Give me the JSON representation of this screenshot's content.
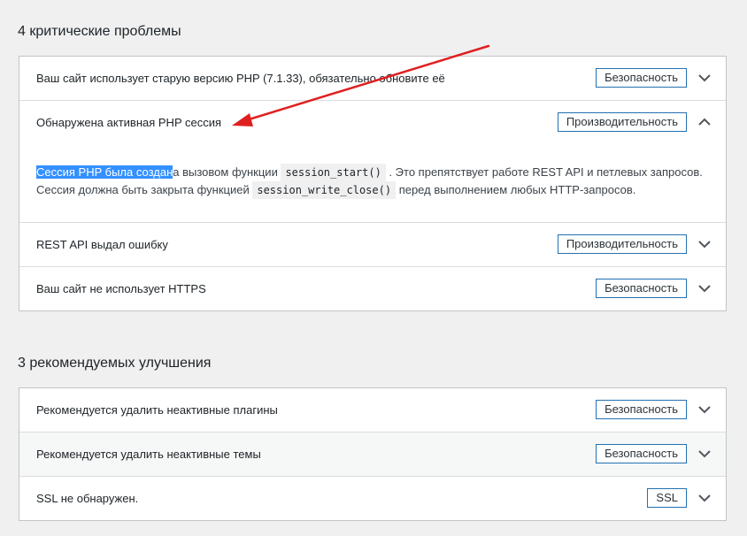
{
  "critical": {
    "heading": "4 критические проблемы",
    "items": [
      {
        "title": "Ваш сайт использует старую версию PHP (7.1.33), обязательно обновите её",
        "badge": "Безопасность",
        "expanded": false
      },
      {
        "title": "Обнаружена активная PHP сессия",
        "badge": "Производительность",
        "expanded": true,
        "body": {
          "selected_text": "Сессия PHP была создан",
          "text_1": "а вызовом функции",
          "code_1": "session_start()",
          "text_2": ". Это препятствует работе REST API и петлевых запросов.",
          "text_3": "Сессия должна быть закрыта функцией",
          "code_2": "session_write_close()",
          "text_4": "перед выполнением любых HTTP-запросов."
        }
      },
      {
        "title": "REST API выдал ошибку",
        "badge": "Производительность",
        "expanded": false
      },
      {
        "title": "Ваш сайт не использует HTTPS",
        "badge": "Безопасность",
        "expanded": false
      }
    ]
  },
  "recommended": {
    "heading": "3 рекомендуемых улучшения",
    "items": [
      {
        "title": "Рекомендуется удалить неактивные плагины",
        "badge": "Безопасность",
        "expanded": false
      },
      {
        "title": "Рекомендуется удалить неактивные темы",
        "badge": "Безопасность",
        "expanded": false,
        "hovered": true
      },
      {
        "title": "SSL не обнаружен.",
        "badge": "SSL",
        "expanded": false
      }
    ]
  },
  "colors": {
    "badge_border": "#2271b1",
    "selection": "#3390ff",
    "annotation_arrow": "#e02020"
  },
  "icons": {
    "collapsed": "chevron-down-icon",
    "expanded": "chevron-up-icon"
  }
}
